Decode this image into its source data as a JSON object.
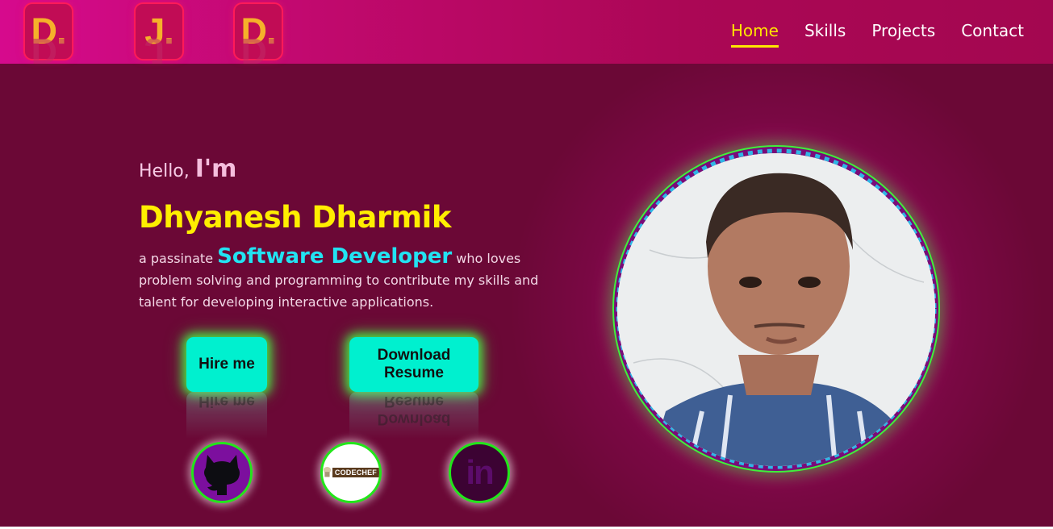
{
  "logo": {
    "letters": [
      "D.",
      "J.",
      "D."
    ]
  },
  "nav": {
    "items": [
      {
        "label": "Home",
        "active": true
      },
      {
        "label": "Skills",
        "active": false
      },
      {
        "label": "Projects",
        "active": false
      },
      {
        "label": "Contact",
        "active": false
      }
    ]
  },
  "hero": {
    "hello": "Hello,",
    "im": "I'm",
    "name": "Dhyanesh Dharmik",
    "desc_prefix": "a passinate",
    "role": "Software Developer",
    "desc_suffix": "who loves problem solving and programming to contribute my skills and talent for developing interactive applications.",
    "hire_label": "Hire me",
    "resume_label": "Download Resume"
  },
  "social": {
    "github": "github-icon",
    "codechef_text": "CODECHEF",
    "linkedin_text": "in"
  },
  "colors": {
    "accent_yellow": "#ffe600",
    "role_cyan": "#22e3f2",
    "button_bg": "#00f0cf",
    "glow_green": "#22e61a",
    "background": "#6b0836"
  }
}
